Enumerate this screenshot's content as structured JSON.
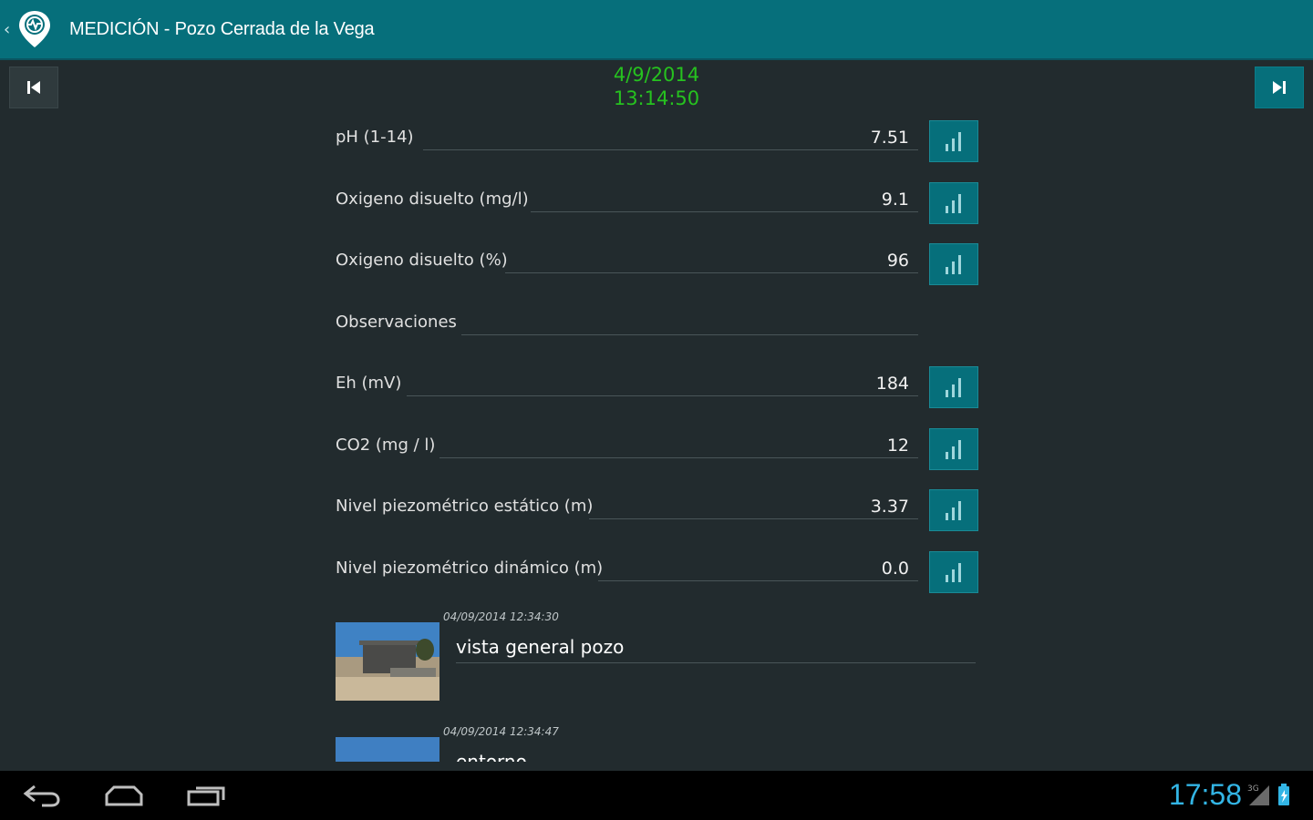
{
  "actionbar": {
    "title": "MEDICIÓN - Pozo Cerrada de la Vega"
  },
  "header": {
    "date": "4/9/2014",
    "time": "13:14:50"
  },
  "measurements": [
    {
      "label": "pH (1-14)",
      "value": "7.51",
      "has_chart": true
    },
    {
      "label": "Oxigeno disuelto (mg/l)",
      "value": "9.1",
      "has_chart": true
    },
    {
      "label": "Oxigeno disuelto (%)",
      "value": "96",
      "has_chart": true
    },
    {
      "label": "Observaciones",
      "value": "",
      "has_chart": false
    },
    {
      "label": "Eh (mV)",
      "value": "184",
      "has_chart": true
    },
    {
      "label": "CO2 (mg / l)",
      "value": "12",
      "has_chart": true
    },
    {
      "label": "Nivel piezométrico estático (m)",
      "value": "3.37",
      "has_chart": true
    },
    {
      "label": "Nivel piezométrico dinámico (m)",
      "value": "0.0",
      "has_chart": true
    }
  ],
  "photos": [
    {
      "timestamp": "04/09/2014 12:34:30",
      "caption": "vista general pozo"
    },
    {
      "timestamp": "04/09/2014 12:34:47",
      "caption": "entorno"
    }
  ],
  "systembar": {
    "clock": "17:58",
    "network": "3G"
  },
  "colors": {
    "actionbar": "#066f7b",
    "background": "#222b2e",
    "datetime": "#26c21f",
    "clock": "#33b5e5"
  }
}
